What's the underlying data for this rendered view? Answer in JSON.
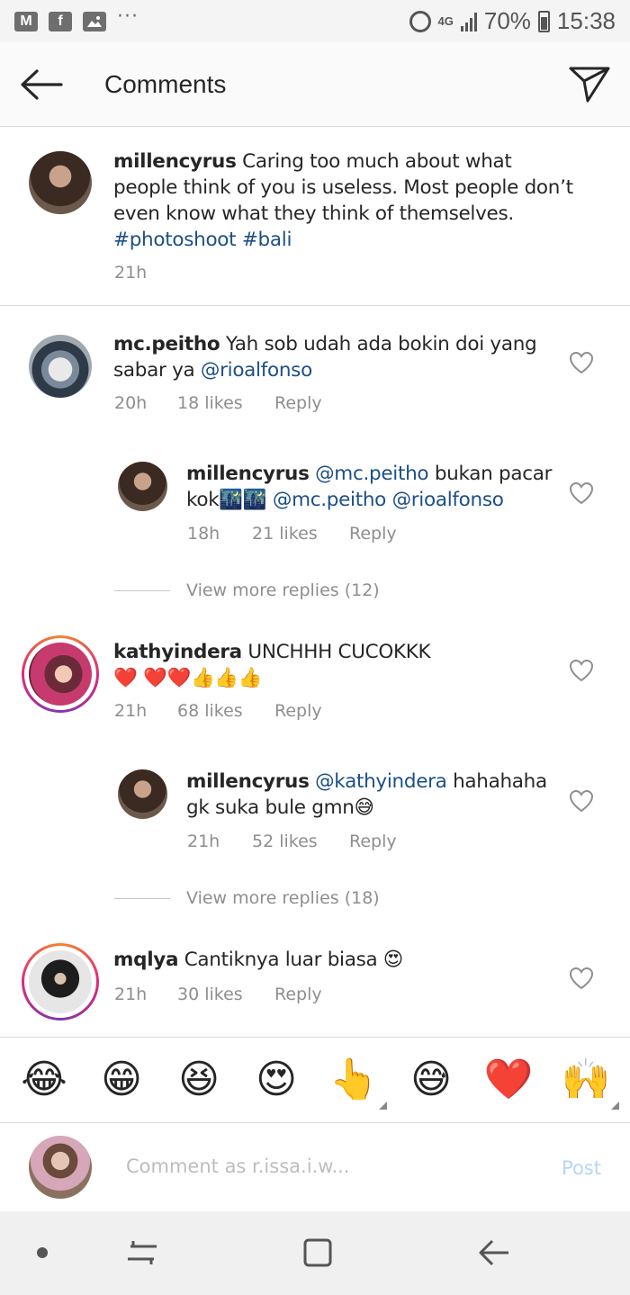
{
  "status_bar": {
    "network": "4G",
    "battery": "70%",
    "time": "15:38",
    "left_icons": [
      "gmail-icon",
      "facebook-icon",
      "gallery-icon"
    ],
    "overflow": "···"
  },
  "header": {
    "title": "Comments",
    "back_icon": "back-arrow-icon",
    "send_icon": "direct-send-icon"
  },
  "caption": {
    "username": "millencyrus",
    "text": " Caring too much about what people think of you is useless. Most people don’t even know what they think of themselves. ",
    "tags": "#photoshoot #bali",
    "time": "21h"
  },
  "comments": [
    {
      "username": "mc.peitho",
      "text": " Yah sob udah ada bokin doi yang sabar ya ",
      "mention": "@rioalfonso",
      "time": "20h",
      "likes": "18 likes",
      "reply": "Reply",
      "replies": [
        {
          "username": "millencyrus",
          "mention1": " @mc.peitho",
          "text": " bukan pacar kok🌃🌃 ",
          "mention2": "@mc.peitho @rioalfonso",
          "time": "18h",
          "likes": "21 likes",
          "reply": "Reply"
        }
      ],
      "view_more": "View more replies (12)"
    },
    {
      "username": "kathyindera",
      "text": " UNCHHH CUCOKKK ❤️ ❤️❤️👍👍👍",
      "time": "21h",
      "likes": "68 likes",
      "reply": "Reply",
      "replies": [
        {
          "username": "millencyrus",
          "mention1": " @kathyindera",
          "text": " hahahaha gk suka bule gmn😅",
          "time": "21h",
          "likes": "52 likes",
          "reply": "Reply"
        }
      ],
      "view_more": "View more replies (18)"
    },
    {
      "username": "mqlya",
      "text": " Cantiknya luar biasa 😍",
      "time": "21h",
      "likes": "30 likes",
      "reply": "Reply"
    }
  ],
  "emoji_bar": [
    "😂",
    "😁",
    "😆",
    "😍",
    "👆",
    "😅",
    "❤️",
    "🙌"
  ],
  "composer": {
    "placeholder": "Comment as r.issa.i.w...",
    "post": "Post"
  },
  "colors": {
    "mention": "#1c4f86",
    "meta": "#8e8e8e",
    "post_disabled": "#b5d6f4",
    "story_ring": "#dd2a7b"
  }
}
